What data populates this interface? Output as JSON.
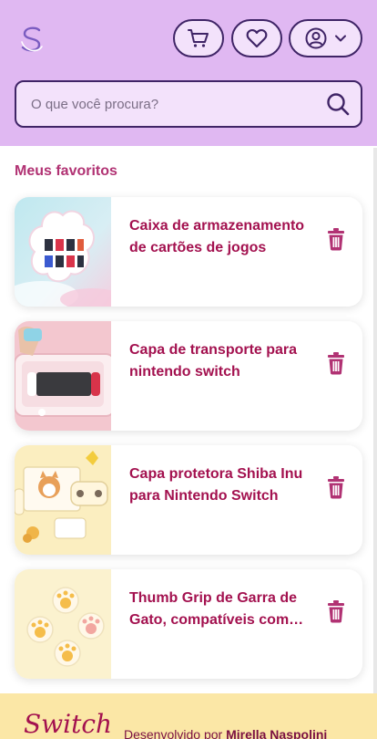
{
  "header": {
    "search_placeholder": "O que você procura?"
  },
  "section": {
    "title": "Meus favoritos"
  },
  "favorites": [
    {
      "title": "Caixa de armazenamento de cartões de jogos"
    },
    {
      "title": "Capa de transporte para nintendo switch"
    },
    {
      "title": "Capa protetora Shiba Inu para Nintendo Switch"
    },
    {
      "title": "Thumb Grip de Garra de Gato, compatíveis com Nintendo Switch"
    }
  ],
  "footer": {
    "logo_text": "Switch",
    "prefix": "Desenvolvido por ",
    "author": "Mirella Naspolini"
  },
  "colors": {
    "header_bg": "#e0b8f2",
    "accent": "#a3114f",
    "outline": "#3f2466",
    "footer_bg": "#fbe7a6"
  }
}
